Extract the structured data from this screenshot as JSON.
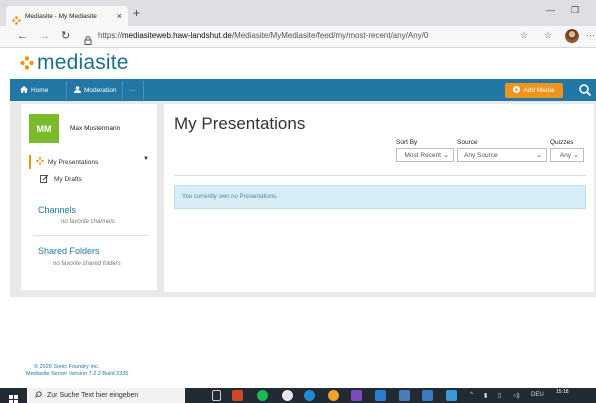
{
  "browser": {
    "tab_title": "Mediasite - My Mediasite",
    "tab_close": "×",
    "new_tab": "+",
    "window_minimize": "—",
    "window_restore": "❐",
    "url_prefix": "https://",
    "url_host": "mediasiteweb.haw-landshut.de",
    "url_path": "/Mediasite/MyMediasite/feed/my/most-recent/any/Any/0"
  },
  "app": {
    "logo_text": "mediasite",
    "accent_color": "#2377a4",
    "orange_color": "#f0931d",
    "nav": {
      "home": "Home",
      "moderation": "Moderation",
      "more": "···",
      "add_media": "Add Media"
    }
  },
  "sidebar": {
    "avatar_initials": "MM",
    "user_name": "Max Mustermann",
    "items": [
      {
        "label": "My Presentations",
        "active": true
      },
      {
        "label": "My Drafts",
        "active": false
      }
    ],
    "channels_heading": "Channels",
    "channels_empty": "no favorite channels",
    "shared_heading": "Shared Folders",
    "shared_empty": "no favorite shared folders"
  },
  "main": {
    "title": "My Presentations",
    "sort_label": "Sort By",
    "sort_value": "Most Recent",
    "source_label": "Source",
    "source_value": "Any Source",
    "quizzes_label": "Quizzes",
    "quizzes_value": "Any",
    "empty_message": "You currently own no Presentations."
  },
  "footer": {
    "copyright": "© 2020 Sonic Foundry Inc.",
    "version": "Mediasite Server Version 7.2.2 Build 2335"
  },
  "taskbar": {
    "search_placeholder": "Zur Suche Text hier eingeben",
    "time": "15:18",
    "lang": "DEU"
  }
}
